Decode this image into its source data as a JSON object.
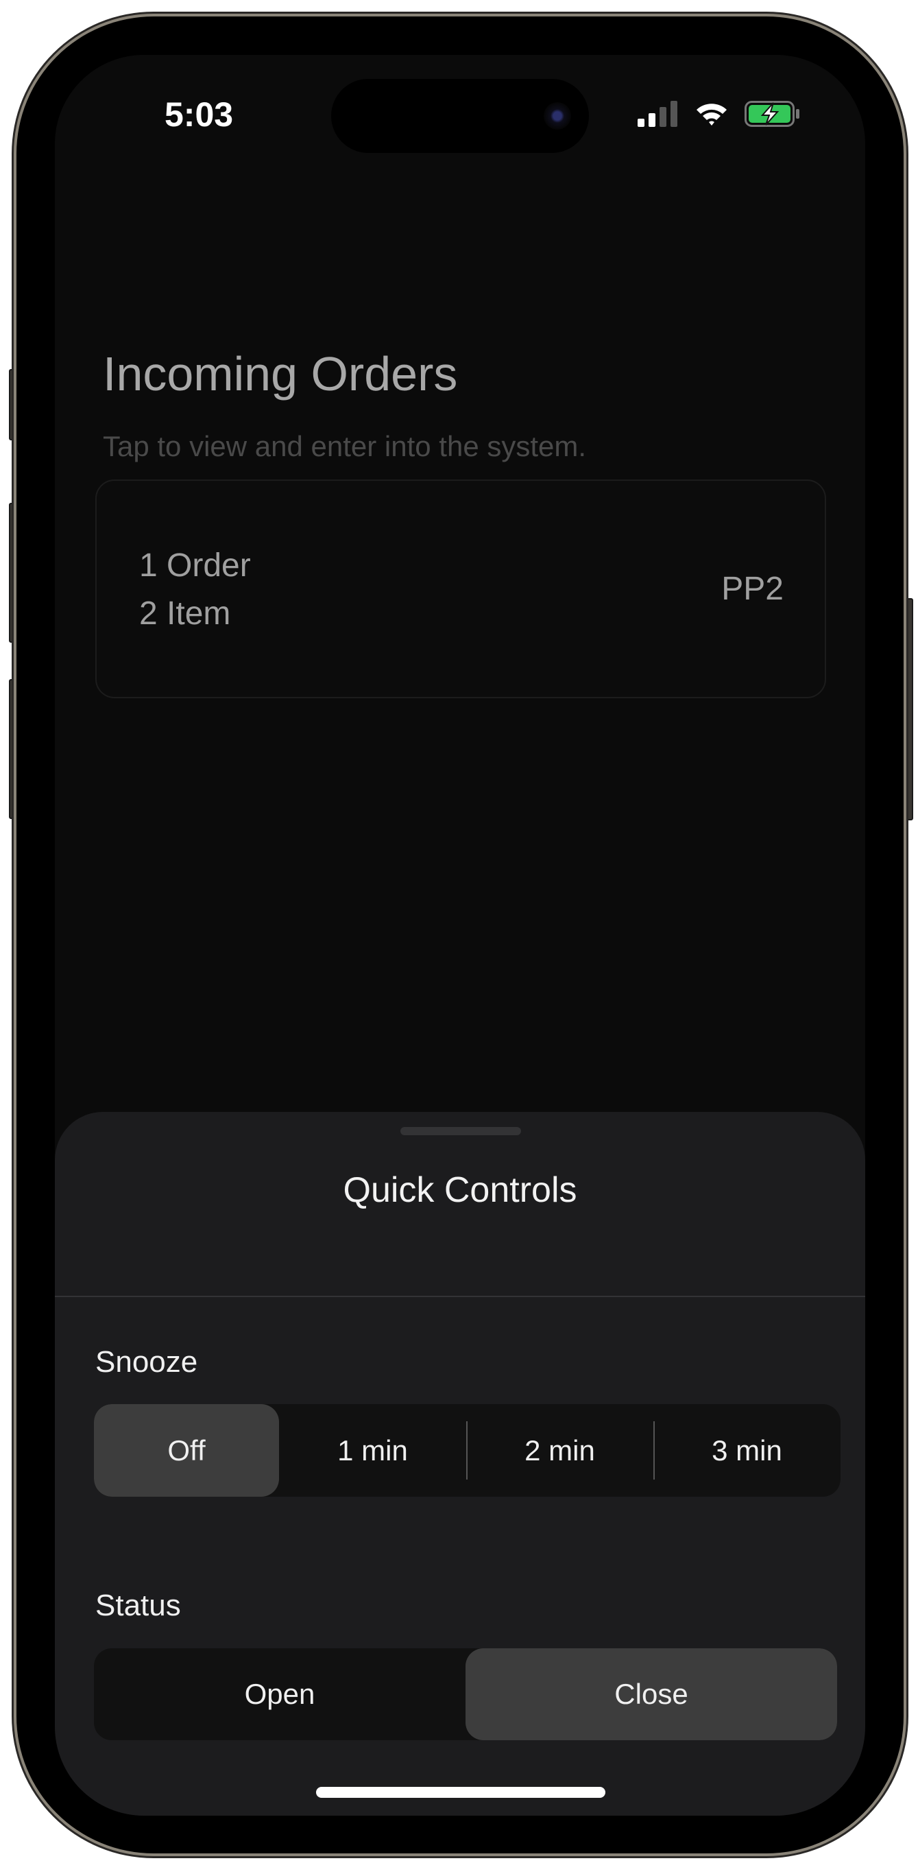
{
  "status_bar": {
    "time": "5:03",
    "icons": [
      "signal-icon",
      "wifi-icon",
      "battery-charging-icon"
    ],
    "battery_color": "#34c759"
  },
  "header": {
    "title": "Incoming Orders",
    "subtitle": "Tap to view and enter into the system."
  },
  "orders_card": {
    "line1": "1 Order",
    "line2": "2 Item",
    "location": "PP2"
  },
  "quick_controls": {
    "title": "Quick Controls",
    "snooze": {
      "label": "Snooze",
      "options": [
        "Off",
        "1 min",
        "2 min",
        "3 min"
      ],
      "selected": "Off"
    },
    "status": {
      "label": "Status",
      "options": [
        "Open",
        "Close"
      ],
      "selected": "Close"
    }
  }
}
